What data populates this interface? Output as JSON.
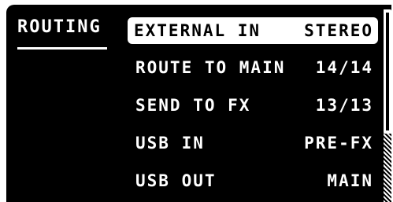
{
  "page": {
    "tab_label": "ROUTING"
  },
  "menu": {
    "items": [
      {
        "label": "EXTERNAL IN",
        "value": "STEREO",
        "selected": true
      },
      {
        "label": "ROUTE TO MAIN",
        "value": "14/14",
        "selected": false
      },
      {
        "label": "SEND TO FX",
        "value": "13/13",
        "selected": false
      },
      {
        "label": "USB IN",
        "value": "PRE-FX",
        "selected": false
      },
      {
        "label": "USB OUT",
        "value": "MAIN",
        "selected": false
      }
    ]
  },
  "colors": {
    "background": "#000000",
    "foreground": "#ffffff"
  }
}
